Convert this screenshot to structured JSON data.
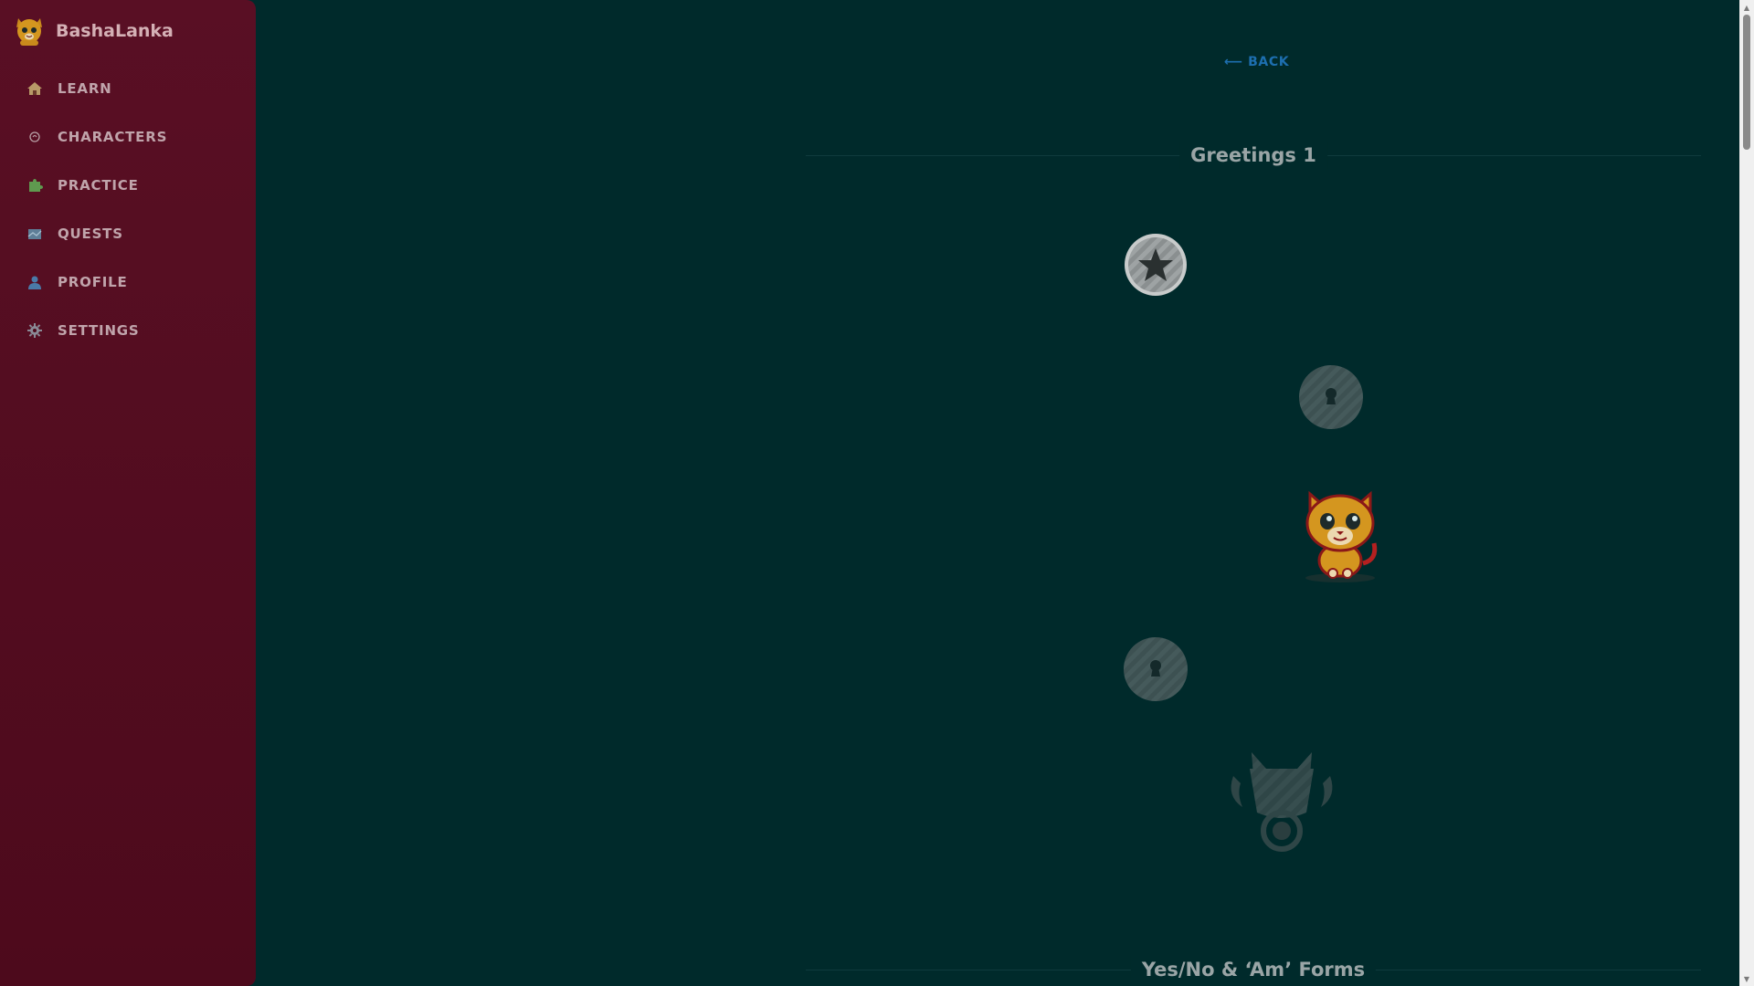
{
  "app": {
    "name": "BashaLanka",
    "logo_icon": "tiger-logo-icon"
  },
  "sidebar": {
    "items": [
      {
        "label": "LEARN",
        "icon": "home-icon",
        "color": "#c7a070"
      },
      {
        "label": "CHARACTERS",
        "icon": "characters-icon",
        "color": "#b8a0a6"
      },
      {
        "label": "PRACTICE",
        "icon": "puzzle-icon",
        "color": "#5f9a4f"
      },
      {
        "label": "QUESTS",
        "icon": "map-icon",
        "color": "#6f8fa8"
      },
      {
        "label": "PROFILE",
        "icon": "person-icon",
        "color": "#4a7aa8"
      },
      {
        "label": "SETTINGS",
        "icon": "gear-icon",
        "color": "#8a8a96"
      }
    ]
  },
  "main": {
    "back_label": "⟵ BACK",
    "sections": [
      {
        "title": "Greetings 1"
      },
      {
        "title": "Yes/No & ‘Am’ Forms"
      }
    ],
    "path_nodes": [
      {
        "type": "active",
        "icon": "star-icon"
      },
      {
        "type": "locked",
        "icon": "lock-icon"
      },
      {
        "type": "mascot",
        "icon": "tiger-mascot-icon"
      },
      {
        "type": "locked",
        "icon": "lock-icon"
      },
      {
        "type": "trophy",
        "icon": "trophy-icon"
      }
    ]
  },
  "colors": {
    "background": "#002a2b",
    "sidebar": "#590f24",
    "accent_link": "#1d6fb0"
  }
}
